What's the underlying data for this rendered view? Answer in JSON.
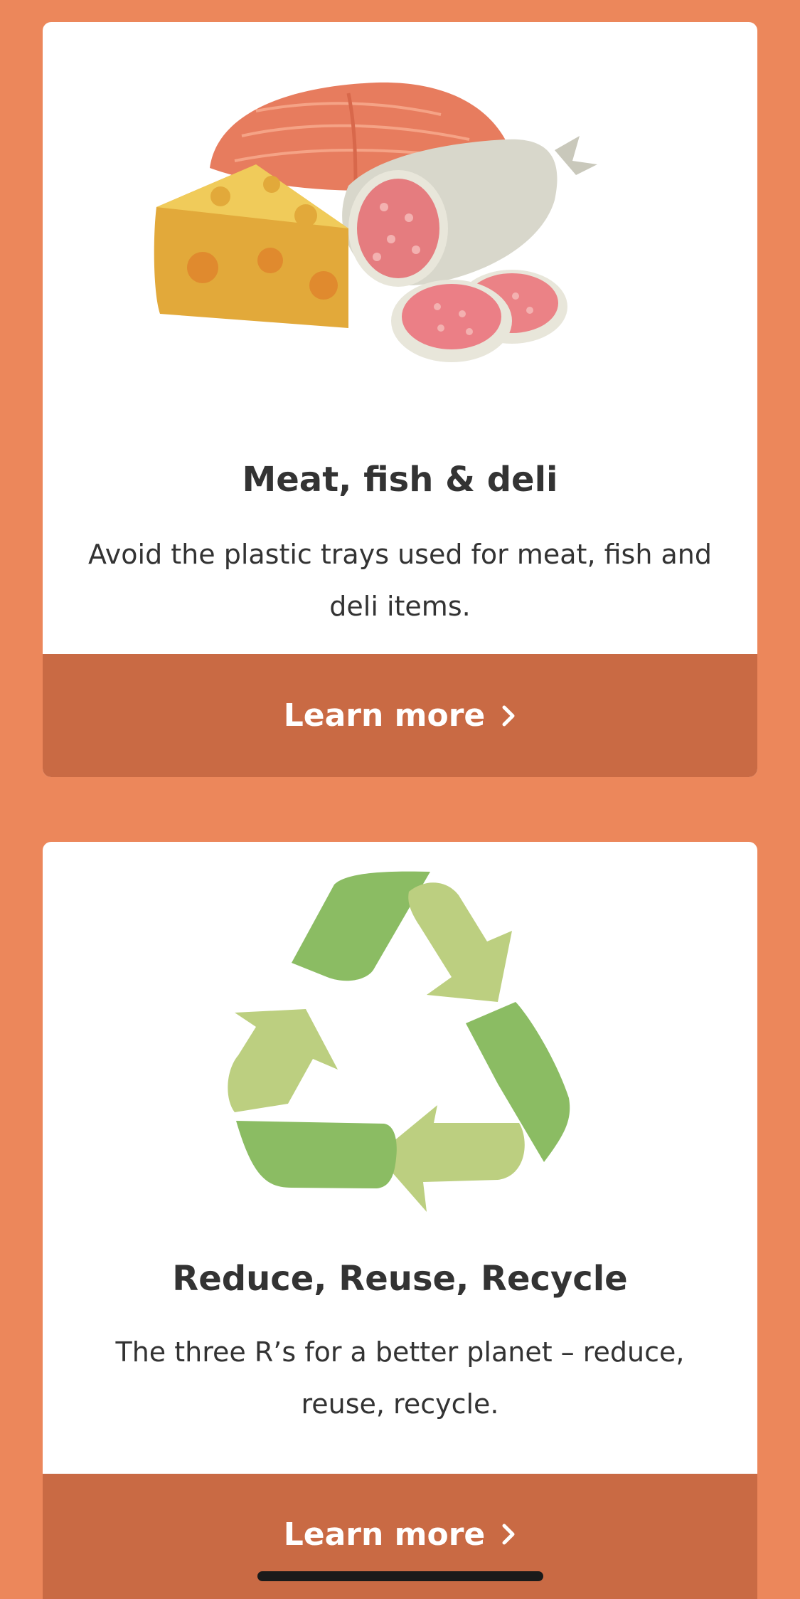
{
  "colors": {
    "background": "#EC875B",
    "card": "#FFFFFF",
    "cta": "#C96A44",
    "text": "#333333"
  },
  "cards": [
    {
      "image": "meat-fish-cheese-salami-illustration",
      "title": "Meat, fish & deli",
      "description": "Avoid the plastic trays used for meat, fish and deli items.",
      "cta_label": "Learn more",
      "cta_icon": "chevron-right-icon"
    },
    {
      "image": "recycle-arrows-illustration",
      "title": "Reduce, Reuse, Recycle",
      "description": "The three R’s for a better planet – reduce, reuse, recycle.",
      "cta_label": "Learn more",
      "cta_icon": "chevron-right-icon"
    }
  ]
}
